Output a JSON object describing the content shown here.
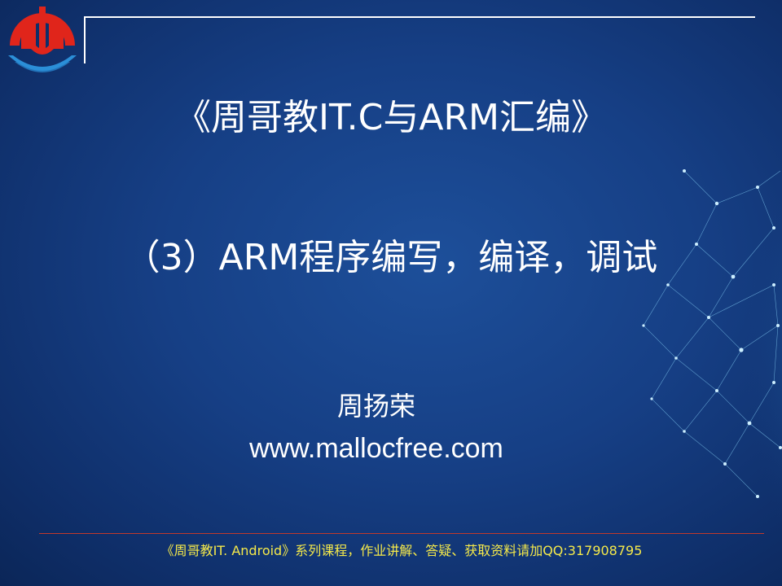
{
  "slide": {
    "title": "《周哥教IT.C与ARM汇编》",
    "subtitle": "（3）ARM程序编写，编译，调试",
    "author": "周扬荣",
    "website": "www.mallocfree.com",
    "footer": "《周哥教IT. Android》系列课程，作业讲解、答疑、获取资料请加QQ:317908795"
  },
  "icons": {
    "logo": "brand-logo-icon",
    "globe": "network-globe-icon"
  },
  "colors": {
    "background": "#163f85",
    "text": "#ffffff",
    "footer_text": "#f5e94a",
    "footer_rule": "#c0392b",
    "logo_red": "#e0251b",
    "logo_blue": "#2b8fd8"
  }
}
